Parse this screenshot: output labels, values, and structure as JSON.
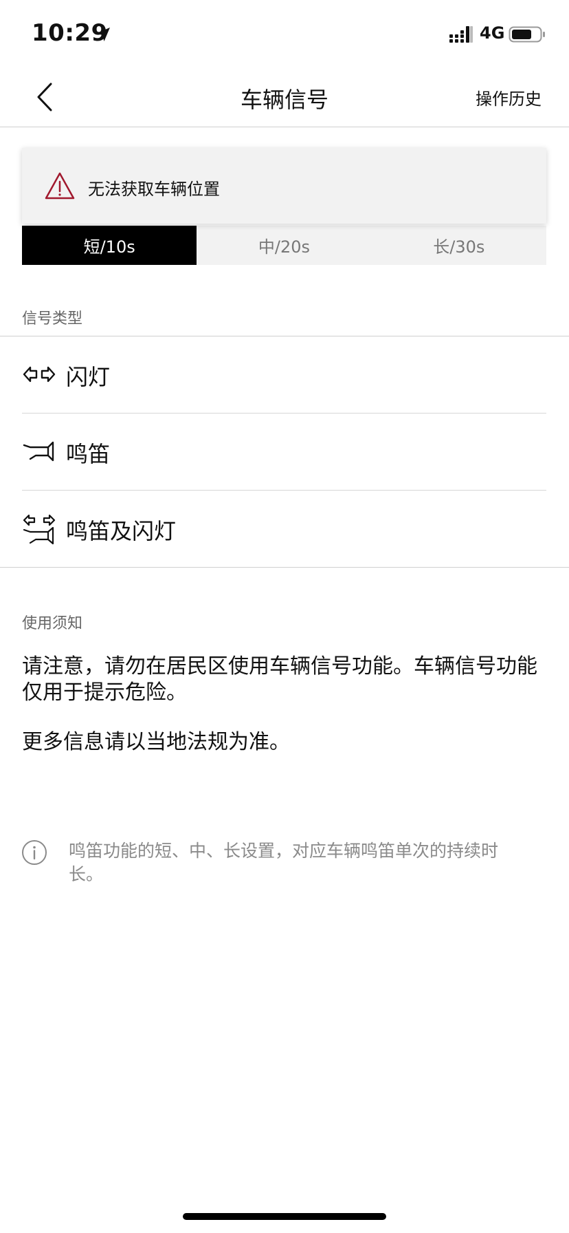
{
  "status_bar": {
    "time": "10:29",
    "network": "4G"
  },
  "nav": {
    "title": "车辆信号",
    "history_label": "操作历史"
  },
  "warning": {
    "text": "无法获取车辆位置",
    "color": "#a0182d"
  },
  "duration_tabs": [
    {
      "label": "短/10s",
      "selected": true
    },
    {
      "label": "中/20s",
      "selected": false
    },
    {
      "label": "长/30s",
      "selected": false
    }
  ],
  "signal_types": {
    "section_label": "信号类型",
    "items": [
      {
        "label": "闪灯",
        "icon": "flash-lights-icon"
      },
      {
        "label": "鸣笛",
        "icon": "horn-icon"
      },
      {
        "label": "鸣笛及闪灯",
        "icon": "horn-and-lights-icon"
      }
    ]
  },
  "usage_notice": {
    "section_label": "使用须知",
    "paragraph_1": "请注意，请勿在居民区使用车辆信号功能。车辆信号功能仅用于提示危险。",
    "paragraph_2": "更多信息请以当地法规为准。"
  },
  "info_note": {
    "text": "鸣笛功能的短、中、长设置，对应车辆鸣笛单次的持续时长。"
  }
}
